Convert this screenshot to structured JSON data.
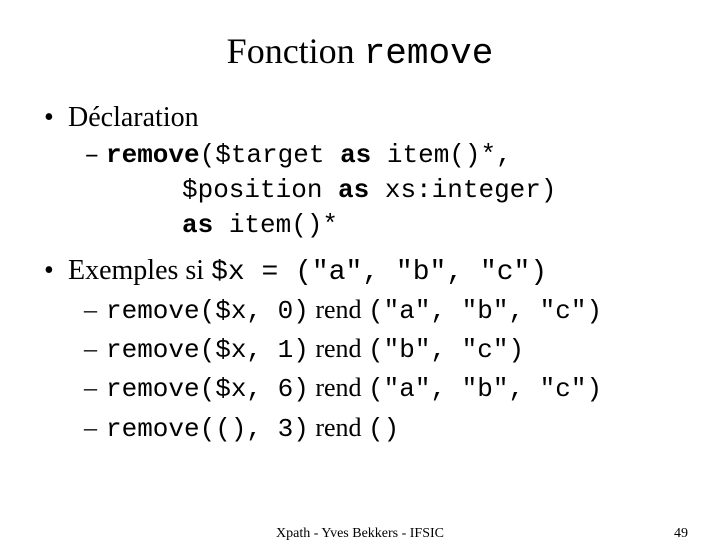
{
  "title": {
    "text": "Fonction ",
    "code": "remove"
  },
  "sections": {
    "declaration": {
      "label": "Déclaration",
      "line1_pre": "remove",
      "line1_mid": "($target ",
      "line1_kw": "as",
      "line1_post": " item()*,",
      "line2_pre": "$position ",
      "line2_kw": "as",
      "line2_post": " xs:integer)",
      "line3_kw": "as",
      "line3_post": " item()*"
    },
    "examples": {
      "label_pre": "Exemples si ",
      "label_code": "$x = (\"a\", \"b\", \"c\")",
      "rows": [
        {
          "call": "remove($x, 0)",
          "rend": " rend ",
          "result": "(\"a\", \"b\", \"c\")"
        },
        {
          "call": "remove($x, 1)",
          "rend": " rend ",
          "result": "(\"b\", \"c\")"
        },
        {
          "call": "remove($x, 6)",
          "rend": " rend ",
          "result": "(\"a\", \"b\", \"c\")"
        },
        {
          "call": "remove((), 3)",
          "rend": " rend ",
          "result": "()"
        }
      ]
    }
  },
  "footer": {
    "center": "Xpath - Yves Bekkers - IFSIC",
    "page": "49"
  }
}
